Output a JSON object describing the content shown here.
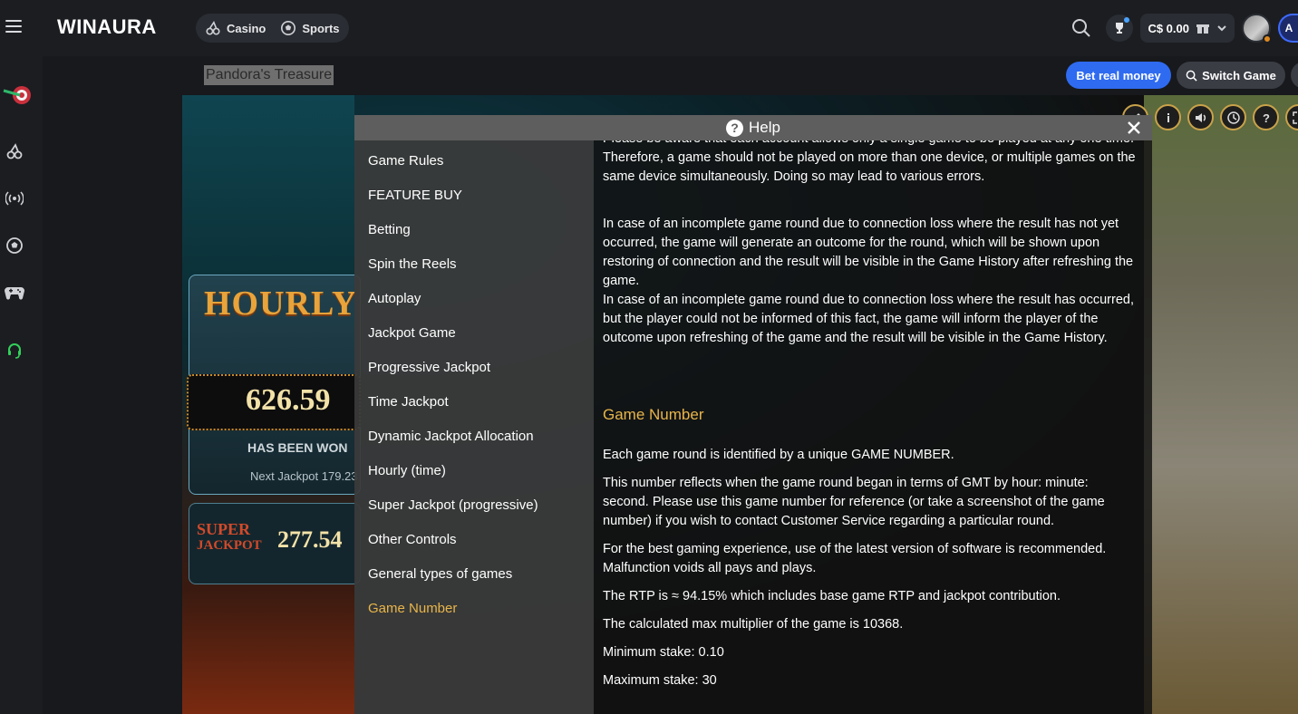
{
  "header": {
    "logo": "WINAURA",
    "nav": [
      {
        "label": "Casino",
        "icon": "cherry-icon"
      },
      {
        "label": "Sports",
        "icon": "soccer-ball-icon"
      }
    ],
    "balance": "C$ 0.00"
  },
  "sidebar": {
    "icons": [
      "target-icon",
      "cherry-icon",
      "live-broadcast-icon",
      "soccer-ball-icon",
      "gamepad-icon",
      "support-headset-icon"
    ]
  },
  "game": {
    "title": "Pandora's Treasure",
    "bet_real_label": "Bet real money",
    "switch_label": "Switch Game",
    "jackpot": {
      "hourly_label": "HOURLY",
      "amount": "626.59",
      "won_text": "HAS BEEN WON",
      "next_text": "Next Jackpot 179.23",
      "super_label_1": "SUPER",
      "super_label_2": "JACKPOT",
      "super_amount": "277.54"
    },
    "controls": [
      "edit-icon",
      "info-icon",
      "sound-icon",
      "history-icon",
      "help-icon",
      "fullscreen-icon"
    ]
  },
  "help": {
    "title": "Help",
    "nav": [
      "Game Rules",
      "FEATURE BUY",
      "Betting",
      "Spin the Reels",
      "Autoplay",
      "Jackpot Game",
      "Progressive Jackpot",
      "Time Jackpot",
      "Dynamic Jackpot Allocation",
      "Hourly (time)",
      "Super Jackpot (progressive)",
      "Other Controls",
      "General types of games",
      "Game Number"
    ],
    "active_nav": "Game Number",
    "body": {
      "p1": "Please be aware that each account allows only a single game to be played at any one time. Therefore, a game should not be played on more than one device, or multiple games on the same device simultaneously. Doing so may lead to various errors.",
      "p2": "In case of an incomplete game round due to connection loss where the result has not yet occurred, the game will generate an outcome for the round, which will be shown upon restoring of connection and the result will be visible in the Game History after refreshing the game.",
      "p3": "In case of an incomplete game round due to connection loss where the result has occurred, but the player could not be informed of this fact, the game will inform the player of the outcome upon refreshing of the game and the result will be visible in the Game History.",
      "section_title": "Game Number",
      "p4": "Each game round is identified by a unique GAME NUMBER.",
      "p5": "This number reflects when the game round began in terms of GMT by hour: minute: second. Please use this game number for reference (or take a screenshot of the game number) if you wish to contact Customer Service regarding a particular round.",
      "p6": "For the best gaming experience, use of the latest version of software is recommended. Malfunction voids all pays and plays.",
      "p7": "The RTP is ≈ 94.15% which includes base game RTP and jackpot contribution.",
      "p8": "The calculated max multiplier of the game is 10368.",
      "p9": "Minimum stake: 0.10",
      "p10": "Maximum stake: 30"
    }
  }
}
